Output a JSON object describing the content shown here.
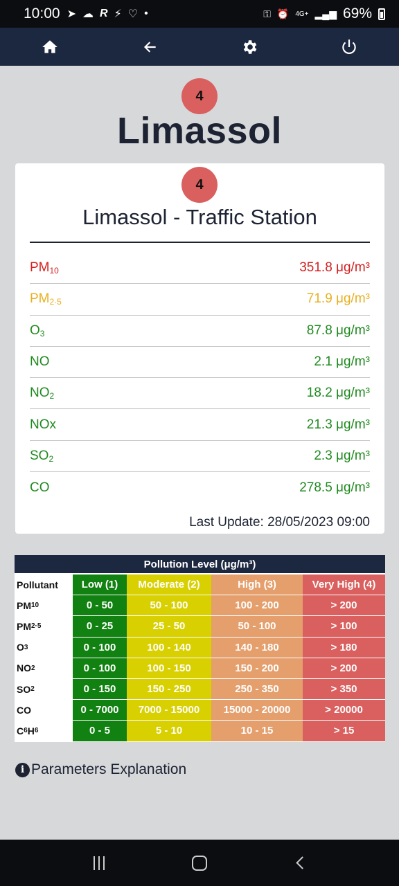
{
  "status_bar": {
    "time": "10:00",
    "battery": "69%",
    "network": "4G+",
    "icons": [
      "telegram-icon",
      "cloud-icon",
      "r-icon",
      "activity-icon",
      "heart-icon",
      "dot-icon",
      "key-icon",
      "alarm-icon",
      "network-icon",
      "signal-icon",
      "battery-icon"
    ]
  },
  "navbar": {
    "items": [
      "home-icon",
      "back-arrow-icon",
      "settings-gear-icon",
      "power-icon"
    ]
  },
  "city": {
    "badge": "4",
    "name": "Limassol"
  },
  "station": {
    "badge": "4",
    "name": "Limassol - Traffic Station",
    "pollutants": [
      {
        "name": "PM",
        "sub": "10",
        "value": "351.8 μg/m³",
        "color": "#d42020"
      },
      {
        "name": "PM",
        "sub": "2·5",
        "value": "71.9 μg/m³",
        "color": "#e8b020"
      },
      {
        "name": "O",
        "sub": "3",
        "value": "87.8 μg/m³",
        "color": "#1f8a1f"
      },
      {
        "name": "NO",
        "sub": "",
        "value": "2.1 μg/m³",
        "color": "#1f8a1f"
      },
      {
        "name": "NO",
        "sub": "2",
        "value": "18.2 μg/m³",
        "color": "#1f8a1f"
      },
      {
        "name": "NOx",
        "sub": "",
        "value": "21.3 μg/m³",
        "color": "#1f8a1f"
      },
      {
        "name": "SO",
        "sub": "2",
        "value": "2.3 μg/m³",
        "color": "#1f8a1f"
      },
      {
        "name": "CO",
        "sub": "",
        "value": "278.5 μg/m³",
        "color": "#1f8a1f"
      }
    ],
    "last_update": "Last Update: 28/05/2023 09:00"
  },
  "legend": {
    "title": "Pollution Level (μg/m³)",
    "headers": [
      "Pollutant",
      "Low (1)",
      "Moderate (2)",
      "High (3)",
      "Very High (4)"
    ],
    "rows": [
      {
        "name": "PM",
        "sub": "10",
        "name_tail": "",
        "low": "0 - 50",
        "moderate": "50 - 100",
        "high": "100 - 200",
        "very_high": "> 200"
      },
      {
        "name": "PM",
        "sub": "2·5",
        "name_tail": "",
        "low": "0 - 25",
        "moderate": "25 - 50",
        "high": "50 - 100",
        "very_high": "> 100"
      },
      {
        "name": "O",
        "sub": "3",
        "name_tail": "",
        "low": "0 - 100",
        "moderate": "100 - 140",
        "high": "140 - 180",
        "very_high": "> 180"
      },
      {
        "name": "NO",
        "sub": "2",
        "name_tail": "",
        "low": "0 - 100",
        "moderate": "100 - 150",
        "high": "150 - 200",
        "very_high": "> 200"
      },
      {
        "name": "SO",
        "sub": "2",
        "name_tail": "",
        "low": "0 - 150",
        "moderate": "150 - 250",
        "high": "250 - 350",
        "very_high": "> 350"
      },
      {
        "name": "CO",
        "sub": "",
        "name_tail": "",
        "low": "0 - 7000",
        "moderate": "7000 - 15000",
        "high": "15000 - 20000",
        "very_high": "> 20000"
      },
      {
        "name": "C",
        "sub": "6",
        "name_tail": "H",
        "sub2": "6",
        "low": "0 - 5",
        "moderate": "5 - 10",
        "high": "10 - 15",
        "very_high": "> 15"
      }
    ],
    "colors": {
      "low": "#118111",
      "moderate": "#d8d000",
      "high": "#e49f6d",
      "very_high": "#d9605e"
    }
  },
  "params_link": {
    "icon": "info-icon",
    "label": "Parameters Explanation"
  },
  "system_nav": [
    "recents-icon",
    "home-button-icon",
    "back-chevron-icon"
  ]
}
